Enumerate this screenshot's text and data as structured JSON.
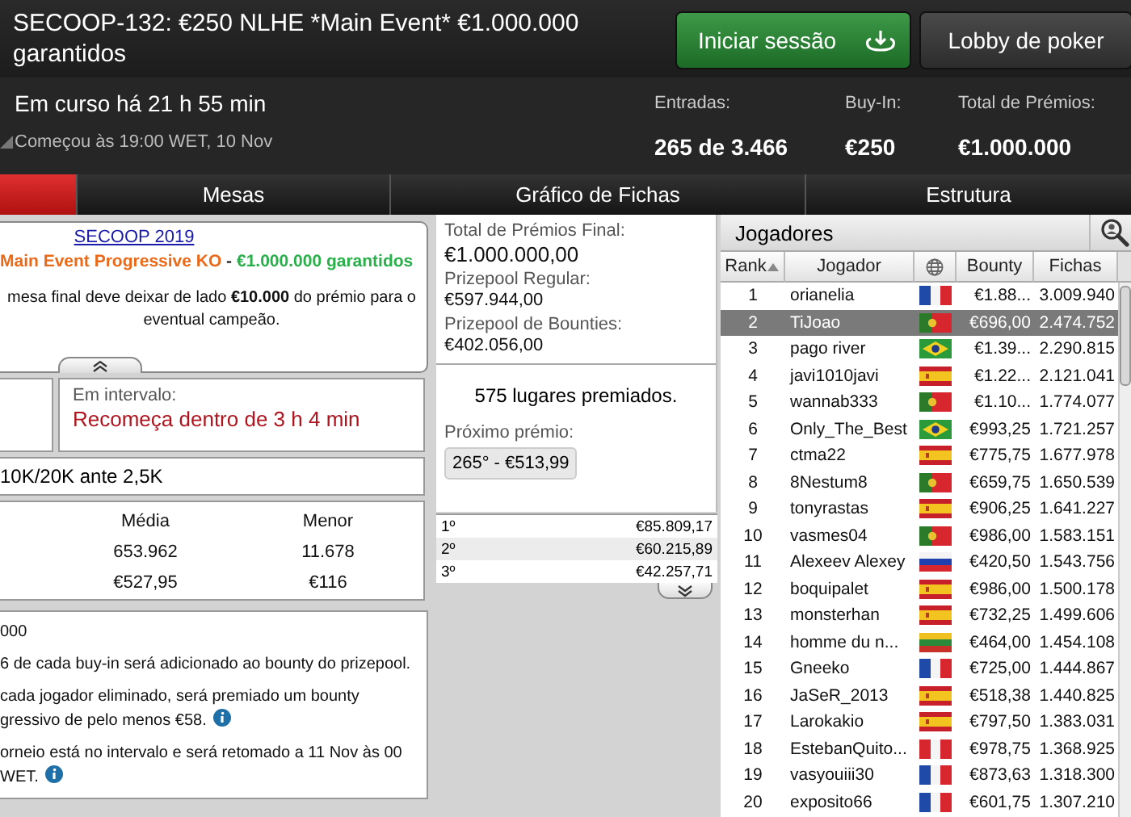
{
  "header": {
    "title": "SECOOP-132: €250 NLHE *Main Event* €1.000.000 garantidos",
    "login_button": "Iniciar sessão",
    "lobby_button": "Lobby de poker",
    "running": "Em curso há 21 h 55 min",
    "started": "Começou às 19:00 WET, 10 Nov",
    "stats": [
      {
        "label": "Entradas:",
        "value": "265 de 3.466"
      },
      {
        "label": "Buy-In:",
        "value": "€250"
      },
      {
        "label": "Total de Prémios:",
        "value": "€1.000.000"
      }
    ]
  },
  "tabs": [
    {
      "selected": true
    },
    {
      "label": "Mesas",
      "selected": false
    },
    {
      "label": "Gráfico de Fichas",
      "selected": false
    },
    {
      "label": "Estrutura",
      "selected": false
    }
  ],
  "promo": {
    "link": "SECOOP 2019",
    "event": "Main Event Progressive KO",
    "separator": " - ",
    "guarantee": "€1.000.000 garantidos",
    "note": "mesa final deve deixar de lado **€10.000** do prémio para o eventual campeão."
  },
  "break": {
    "label": "Em intervalo:",
    "countdown": "Recomeça dentro de 3 h 4 min"
  },
  "blinds": "10K/20K ante 2,5K",
  "stats_table": {
    "columns": [
      "Média",
      "Menor"
    ],
    "rows": [
      [
        "653.962",
        "11.678"
      ],
      [
        "€527,95",
        "€116"
      ]
    ]
  },
  "notes": [
    {
      "text": "000",
      "info_icon": false
    },
    {
      "text": "6 de cada buy-in será adicionado ao bounty do prizepool.",
      "info_icon": false
    },
    {
      "text": "cada jogador eliminado, será premiado um bounty gressivo de pelo menos €58.",
      "info_icon": true
    },
    {
      "text": "orneio está no intervalo e será retomado a 11 Nov às 00 WET.",
      "info_icon": true
    }
  ],
  "prizes": {
    "pools": [
      {
        "label": "Total de Prémios Final:",
        "value": "€1.000.000,00",
        "main": true
      },
      {
        "label": "Prizepool Regular:",
        "value": "€597.944,00",
        "main": false
      },
      {
        "label": "Prizepool de Bounties:",
        "value": "€402.056,00",
        "main": false
      }
    ],
    "paid": "575 lugares premiados.",
    "next_label": "Próximo prémio:",
    "next_value": "265° - €513,99",
    "places": [
      {
        "place": "1º",
        "amount": "€85.809,17"
      },
      {
        "place": "2º",
        "amount": "€60.215,89"
      },
      {
        "place": "3º",
        "amount": "€42.257,71"
      }
    ]
  },
  "players": {
    "title": "Jogadores",
    "columns": [
      {
        "kind": "text",
        "label": "Rank",
        "sorted": true
      },
      {
        "kind": "text",
        "label": "Jogador",
        "sorted": false
      },
      {
        "kind": "globe",
        "sorted": false
      },
      {
        "kind": "text",
        "label": "Bounty",
        "sorted": false
      },
      {
        "kind": "text",
        "label": "Fichas",
        "sorted": false
      }
    ],
    "rows": [
      {
        "rank": "1",
        "name": "orianelia",
        "kind": "fr",
        "bounty": "€1.88...",
        "chips": "3.009.940",
        "selected": false
      },
      {
        "rank": "2",
        "name": "TiJoao",
        "kind": "pt",
        "bounty": "€696,00",
        "chips": "2.474.752",
        "selected": true
      },
      {
        "rank": "3",
        "name": "pago river",
        "kind": "br",
        "bounty": "€1.39...",
        "chips": "2.290.815",
        "selected": false
      },
      {
        "rank": "4",
        "name": "javi1010javi",
        "kind": "es",
        "bounty": "€1.22...",
        "chips": "2.121.041",
        "selected": false
      },
      {
        "rank": "5",
        "name": "wannab333",
        "kind": "pt",
        "bounty": "€1.10...",
        "chips": "1.774.077",
        "selected": false
      },
      {
        "rank": "6",
        "name": "Only_The_Best",
        "kind": "br",
        "bounty": "€993,25",
        "chips": "1.721.257",
        "selected": false
      },
      {
        "rank": "7",
        "name": "ctma22",
        "kind": "es",
        "bounty": "€775,75",
        "chips": "1.677.978",
        "selected": false
      },
      {
        "rank": "8",
        "name": "8Nestum8",
        "kind": "pt",
        "bounty": "€659,75",
        "chips": "1.650.539",
        "selected": false
      },
      {
        "rank": "9",
        "name": "tonyrastas",
        "kind": "es",
        "bounty": "€906,25",
        "chips": "1.641.227",
        "selected": false
      },
      {
        "rank": "10",
        "name": "vasmes04",
        "kind": "pt",
        "bounty": "€986,00",
        "chips": "1.583.151",
        "selected": false
      },
      {
        "rank": "11",
        "name": "Alexeev Alexey",
        "kind": "ru",
        "bounty": "€420,50",
        "chips": "1.543.756",
        "selected": false
      },
      {
        "rank": "12",
        "name": "boquipalet",
        "kind": "es",
        "bounty": "€986,00",
        "chips": "1.500.178",
        "selected": false
      },
      {
        "rank": "13",
        "name": "monsterhan",
        "kind": "es",
        "bounty": "€732,25",
        "chips": "1.499.606",
        "selected": false
      },
      {
        "rank": "14",
        "name": "homme du n...",
        "kind": "lt",
        "bounty": "€464,00",
        "chips": "1.454.108",
        "selected": false
      },
      {
        "rank": "15",
        "name": "Gneeko",
        "kind": "fr",
        "bounty": "€725,00",
        "chips": "1.444.867",
        "selected": false
      },
      {
        "rank": "16",
        "name": "JaSeR_2013",
        "kind": "es",
        "bounty": "€518,38",
        "chips": "1.440.825",
        "selected": false
      },
      {
        "rank": "17",
        "name": "Larokakio",
        "kind": "es",
        "bounty": "€797,50",
        "chips": "1.383.031",
        "selected": false
      },
      {
        "rank": "18",
        "name": "EstebanQuito...",
        "kind": "pe",
        "bounty": "€978,75",
        "chips": "1.368.925",
        "selected": false
      },
      {
        "rank": "19",
        "name": "vasyouiii30",
        "kind": "fr",
        "bounty": "€873,63",
        "chips": "1.318.300",
        "selected": false
      },
      {
        "rank": "20",
        "name": "exposito66",
        "kind": "fr",
        "bounty": "€601,75",
        "chips": "1.307.210",
        "selected": false
      }
    ]
  }
}
